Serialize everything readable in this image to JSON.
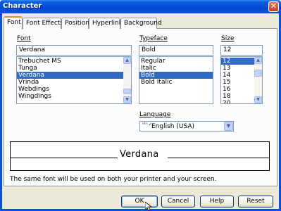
{
  "window": {
    "title": "Character",
    "close_glyph": "✕"
  },
  "tabs": [
    "Font",
    "Font Effects",
    "Position",
    "Hyperlink",
    "Background"
  ],
  "font": {
    "label": "Font",
    "value": "Verdana",
    "items": [
      "Trebuchet MS",
      "Tunga",
      "Verdana",
      "Vrinda",
      "Webdings",
      "Wingdings"
    ],
    "selected": "Verdana"
  },
  "typeface": {
    "label": "Typeface",
    "value": "Bold",
    "items": [
      "Regular",
      "Italic",
      "Bold",
      "Bold Italic"
    ],
    "selected": "Bold"
  },
  "size": {
    "label": "Size",
    "value": "12",
    "items": [
      "12",
      "13",
      "14",
      "15",
      "16",
      "18",
      "20"
    ],
    "selected": "12"
  },
  "language": {
    "label": "Language",
    "value": "English (USA)",
    "icon": "abc-check-icon"
  },
  "preview": {
    "text": "Verdana"
  },
  "note": "The same font will be used on both your printer and your screen.",
  "buttons": {
    "ok": "OK",
    "cancel": "Cancel",
    "help": "Help",
    "reset": "Reset"
  }
}
